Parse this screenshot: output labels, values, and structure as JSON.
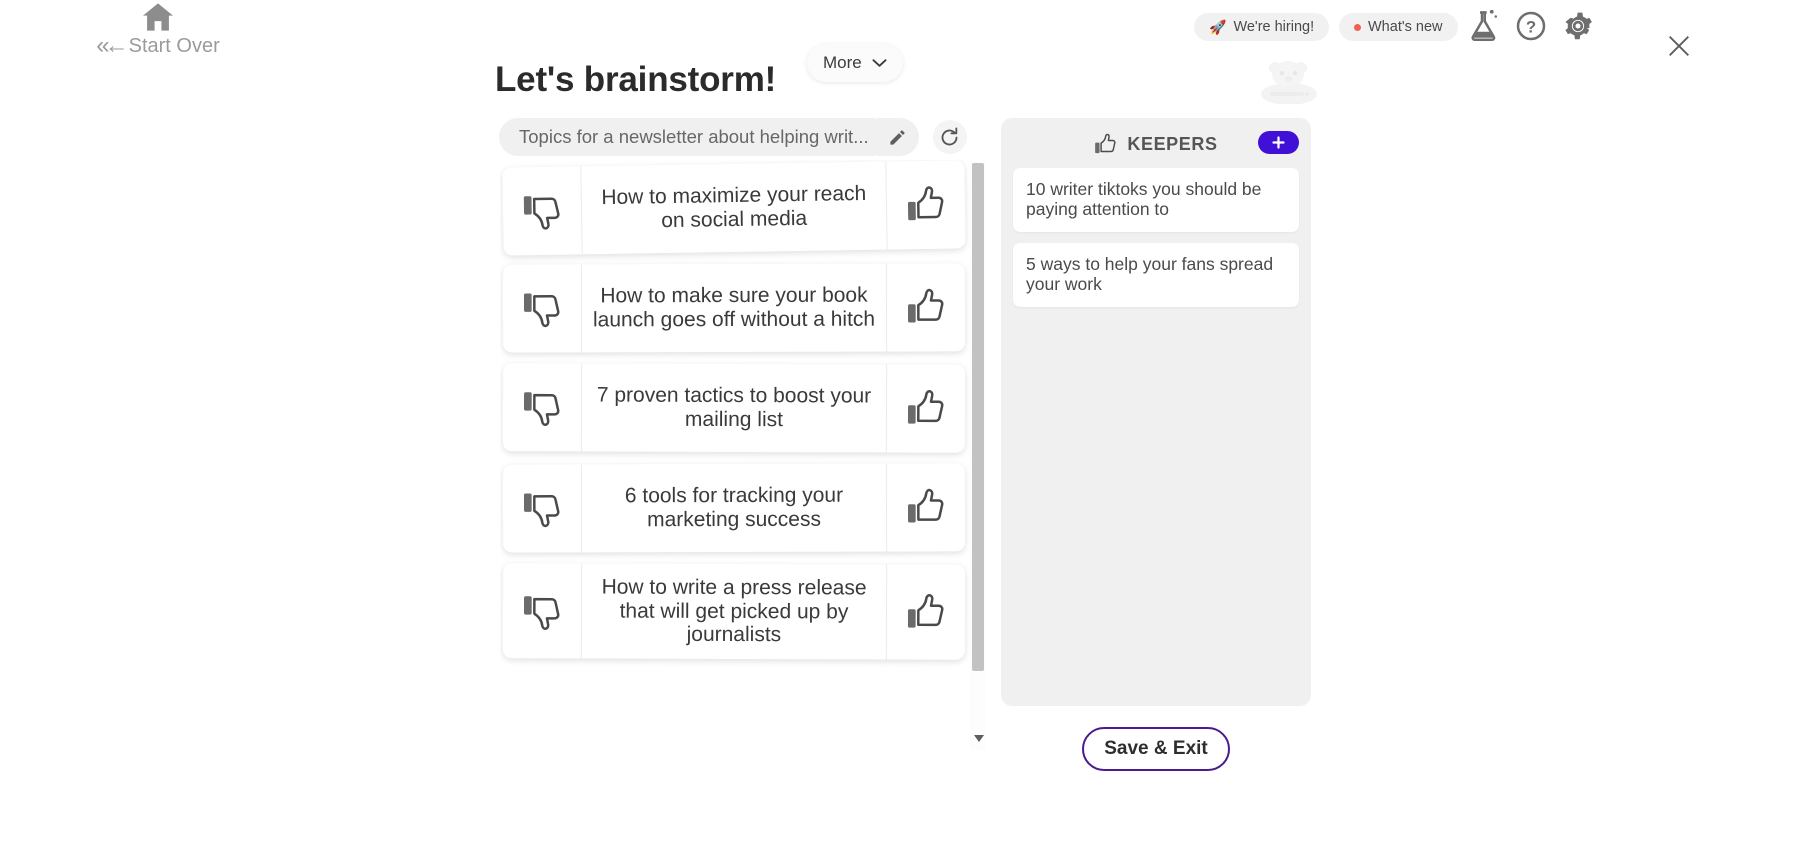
{
  "topbar": {
    "start_over": {
      "label": "Start Over",
      "arrows": "«←",
      "icon": "home-icon"
    },
    "chips": [
      {
        "id": "hiring",
        "label": "We're hiring!",
        "icon": "rocket-icon",
        "icon_glyph": "🚀",
        "marker": "rocket"
      },
      {
        "id": "whatsnew",
        "label": "What's new",
        "icon": "red-dot-icon",
        "marker": "dot",
        "dot_color": "#f0614f"
      }
    ],
    "icons": [
      {
        "id": "flask",
        "name": "flask-icon",
        "title": "Labs"
      },
      {
        "id": "help",
        "name": "help-icon",
        "title": "Help"
      },
      {
        "id": "gear",
        "name": "settings-icon",
        "title": "Settings"
      },
      {
        "id": "close",
        "name": "close-icon",
        "title": "Close"
      }
    ],
    "mascot": "mascot-illustration"
  },
  "header": {
    "title": "Let's brainstorm!",
    "more_label": "More",
    "more_icon": "chevron-down-icon"
  },
  "topic": {
    "value": "Topics for a newsletter about helping writ...",
    "edit_icon": "pencil-icon",
    "refresh_icon": "refresh-icon"
  },
  "ideas": {
    "thumbs_down_icon": "thumbs-down-icon",
    "thumbs_up_icon": "thumbs-up-icon",
    "items": [
      {
        "text": "How to maximize your reach on social media"
      },
      {
        "text": "How to make sure your book launch goes off without a hitch"
      },
      {
        "text": "7 proven tactics to boost your mailing list"
      },
      {
        "text": "6 tools for tracking your marketing success"
      },
      {
        "text": "How to write a press release that will get picked up by journalists"
      }
    ]
  },
  "keepers": {
    "title": "KEEPERS",
    "title_icon": "thumbs-up-icon",
    "add_icon": "plus-icon",
    "add_color": "#4110d6",
    "items": [
      {
        "text": "10 writer tiktoks you should be paying attention to"
      },
      {
        "text": "5 ways to help your fans spread your work"
      }
    ]
  },
  "footer": {
    "save_exit_label": "Save & Exit",
    "save_exit_border_color": "#4a1a8f"
  }
}
